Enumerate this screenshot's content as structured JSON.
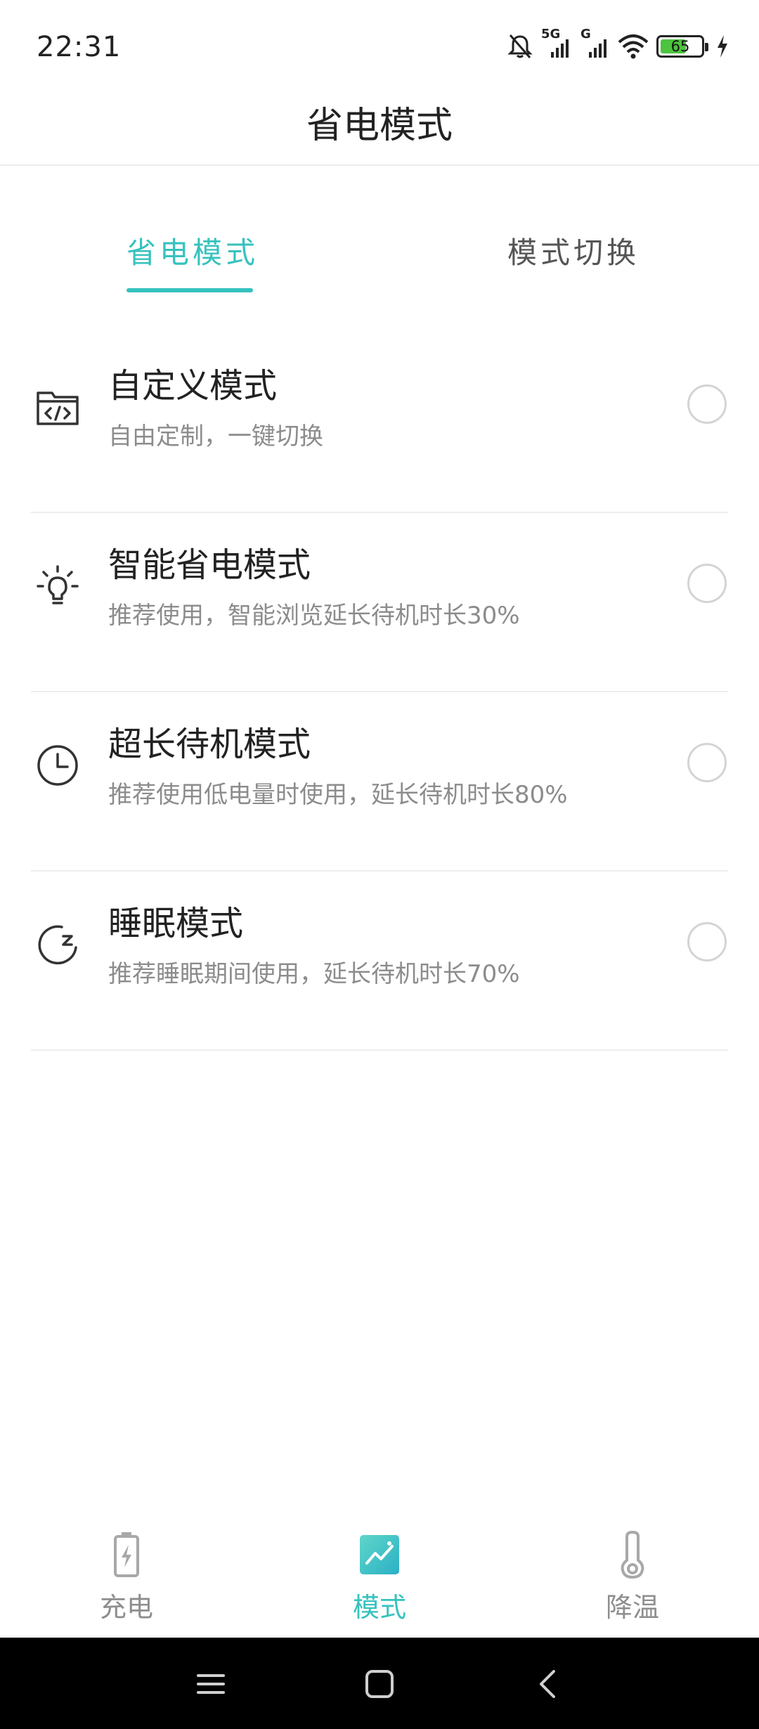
{
  "status_bar": {
    "time": "22:31",
    "network_1": "5G",
    "network_2": "G",
    "battery_level": "65",
    "battery_fraction": 0.65,
    "icons": [
      "mute-bell-icon",
      "signal-icon",
      "signal-icon",
      "wifi-icon",
      "battery-icon",
      "charging-bolt-icon"
    ]
  },
  "header": {
    "title": "省电模式"
  },
  "tabs": [
    {
      "label": "省电模式",
      "active": true
    },
    {
      "label": "模式切换",
      "active": false
    }
  ],
  "modes": [
    {
      "icon": "code-folder-icon",
      "title": "自定义模式",
      "description": "自由定制，一键切换",
      "selected": false
    },
    {
      "icon": "lightbulb-icon",
      "title": "智能省电模式",
      "description": "推荐使用，智能浏览延长待机时长30%",
      "selected": false
    },
    {
      "icon": "clock-icon",
      "title": "超长待机模式",
      "description": "推荐使用低电量时使用，延长待机时长80%",
      "selected": false
    },
    {
      "icon": "moon-sleep-icon",
      "title": "睡眠模式",
      "description": "推荐睡眠期间使用，延长待机时长70%",
      "selected": false
    }
  ],
  "bottom_nav": [
    {
      "label": "充电",
      "icon": "battery-charge-icon",
      "active": false
    },
    {
      "label": "模式",
      "icon": "chart-image-icon",
      "active": true
    },
    {
      "label": "降温",
      "icon": "thermometer-icon",
      "active": false
    }
  ],
  "colors": {
    "accent": "#36c2be",
    "inactive": "#8e8e8e"
  }
}
